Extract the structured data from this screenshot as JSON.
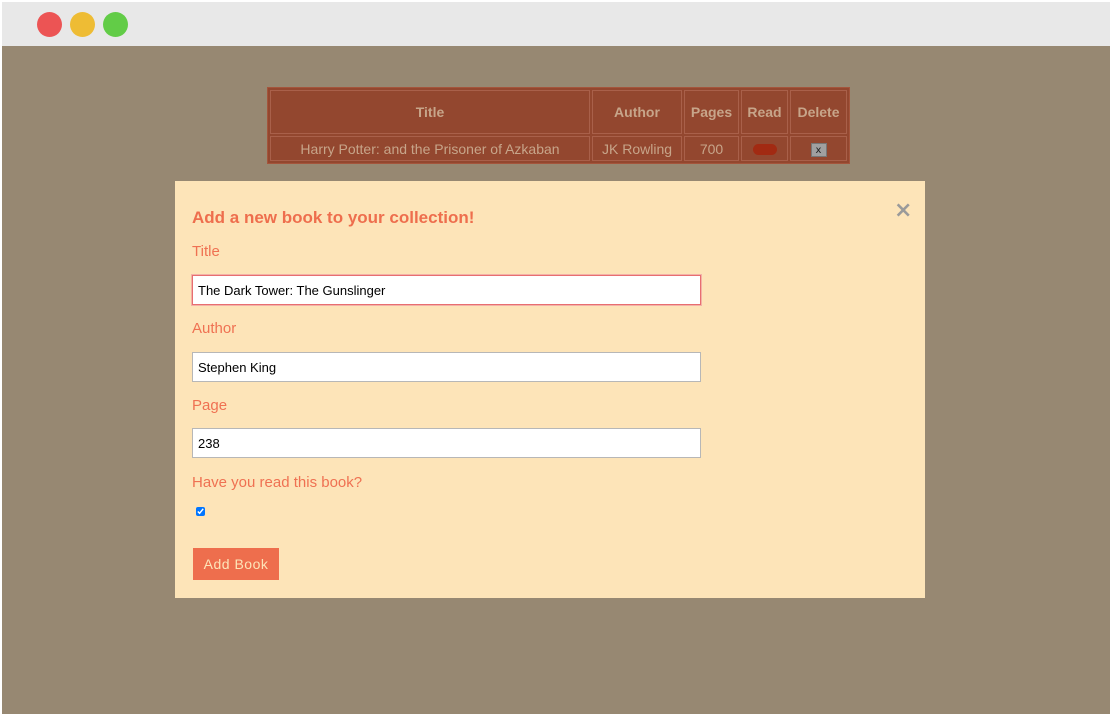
{
  "colors": {
    "window_bg": "#978872",
    "titlebar_bg": "#e8e8e8",
    "dot_red": "#ec5454",
    "dot_yellow": "#eebc34",
    "dot_green": "#62cc47",
    "table_bg": "#93472f",
    "modal_bg": "#fde4b8",
    "accent": "#ee6e4d"
  },
  "table": {
    "headers": {
      "title": "Title",
      "author": "Author",
      "pages": "Pages",
      "read": "Read",
      "delete": "Delete"
    },
    "rows": [
      {
        "title": "Harry Potter: and the Prisoner of Azkaban",
        "author": "JK Rowling",
        "pages": "700",
        "read": true,
        "delete_label": "x"
      }
    ]
  },
  "modal": {
    "close_glyph": "×",
    "heading": "Add a new book to your collection!",
    "title_label": "Title",
    "title_value": "The Dark Tower: The Gunslinger",
    "author_label": "Author",
    "author_value": "Stephen King",
    "page_label": "Page",
    "page_value": "238",
    "read_label": "Have you read this book?",
    "read_checked": true,
    "submit_label": "Add Book"
  }
}
